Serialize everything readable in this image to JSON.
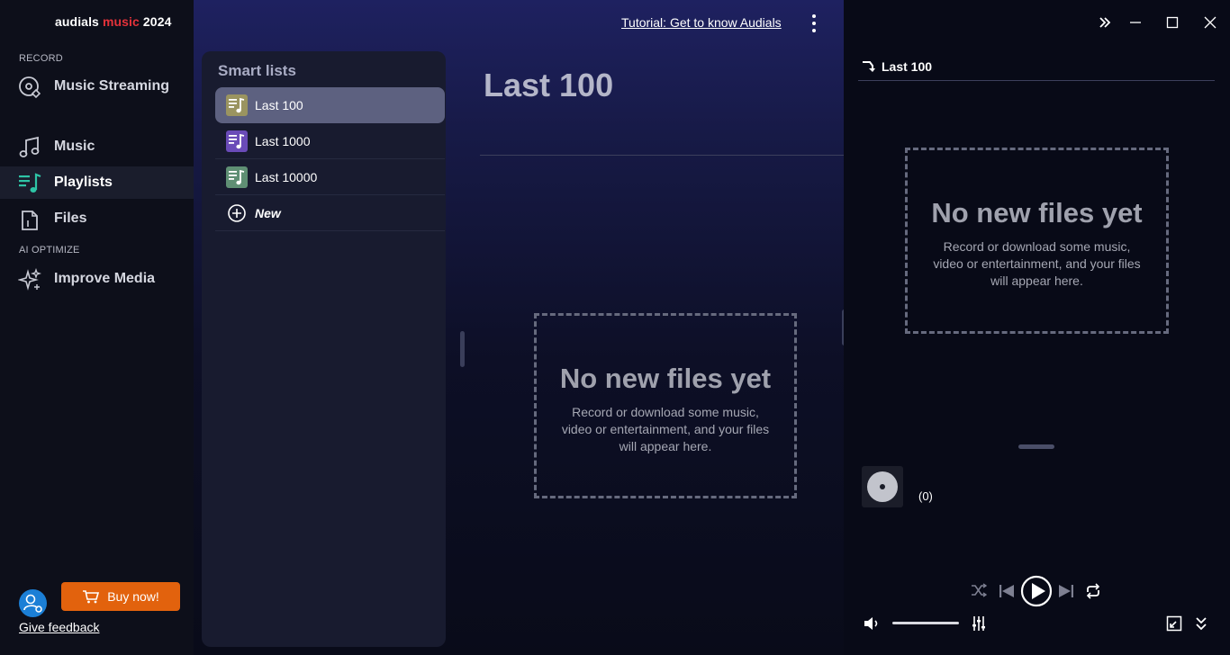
{
  "app": {
    "logo_prefix": "audials",
    "logo_highlight": "music",
    "logo_suffix": "2024"
  },
  "sidebar": {
    "record_label": "RECORD",
    "ai_label": "AI OPTIMIZE",
    "items": [
      {
        "label": "Music Streaming",
        "icon": "streaming-icon"
      },
      {
        "label": "Music",
        "icon": "music-note-icon"
      },
      {
        "label": "Playlists",
        "icon": "playlist-icon",
        "active": true
      },
      {
        "label": "Files",
        "icon": "files-icon"
      },
      {
        "label": "Improve Media",
        "icon": "sparkle-icon"
      }
    ],
    "buy_label": "Buy now!",
    "feedback_label": "Give feedback"
  },
  "header": {
    "tutorial_link": "Tutorial: Get to know Audials"
  },
  "smart_lists": {
    "title": "Smart lists",
    "items": [
      {
        "label": "Last 100",
        "color": "#9a9460"
      },
      {
        "label": "Last 1000",
        "color": "#6a4bb8"
      },
      {
        "label": "Last 10000",
        "color": "#5f8f74"
      }
    ],
    "new_label": "New"
  },
  "content": {
    "title": "Last 100",
    "empty_title": "No new files yet",
    "empty_lines": [
      "Record or download some music,",
      "video or entertainment, and your files",
      "will appear here."
    ]
  },
  "right_panel": {
    "title": "Last 100",
    "empty_title": "No new files yet",
    "empty_lines": [
      "Record or download some music,",
      "video or entertainment, and your files",
      "will appear here."
    ],
    "count": "(0)"
  },
  "colors": {
    "accent_red": "#e5323a",
    "buy_orange": "#e2620d",
    "avatar_blue": "#1b7fd6",
    "playlist_teal": "#2ec4a6"
  }
}
